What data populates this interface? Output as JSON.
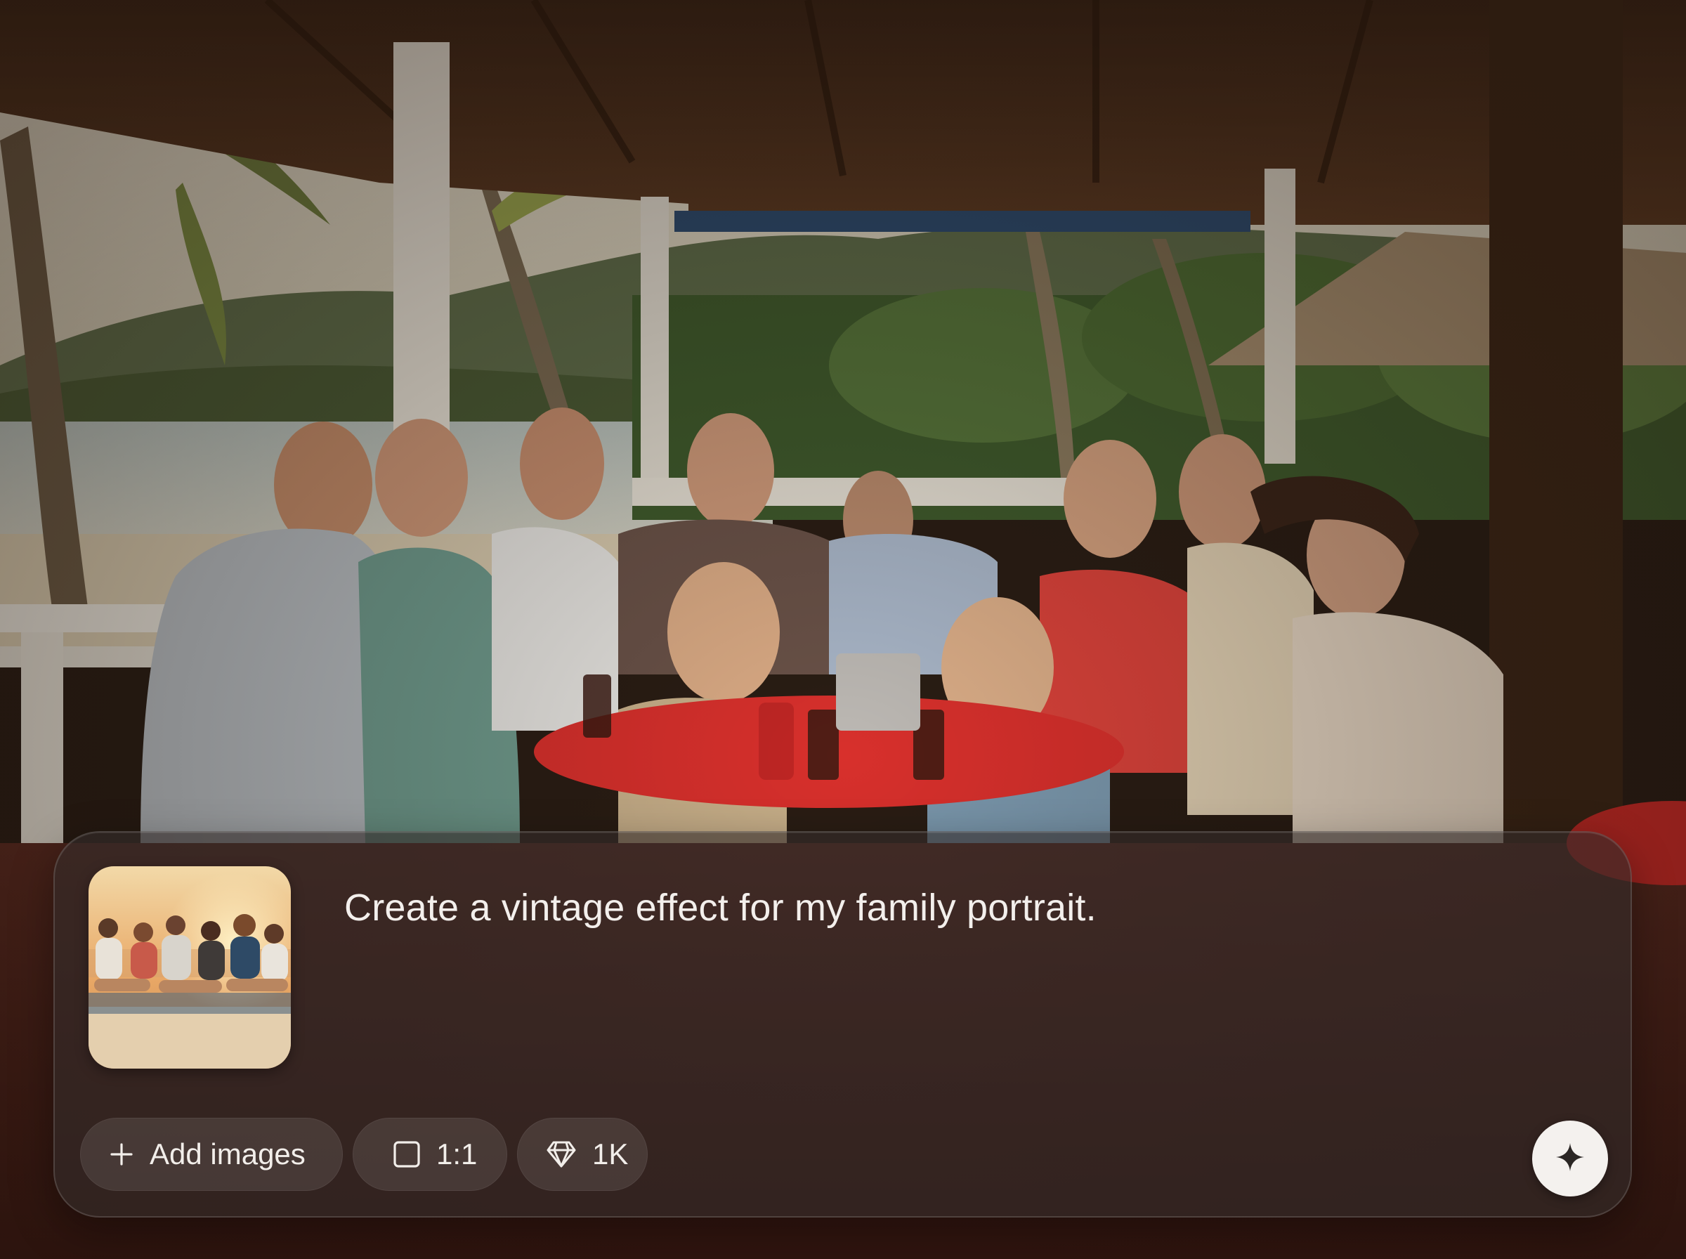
{
  "prompt": {
    "text": "Create a vintage effect for my family portrait."
  },
  "toolbar": {
    "add_images_label": "Add images",
    "aspect_ratio": "1:1",
    "resolution": "1K"
  },
  "icons": {
    "add": "plus-icon",
    "aspect": "square-icon",
    "resolution": "diamond-icon",
    "generate": "sparkle-icon"
  },
  "colors": {
    "panel": "#342c2a",
    "text": "#f3efec",
    "generate_button": "#f4f1ee"
  }
}
